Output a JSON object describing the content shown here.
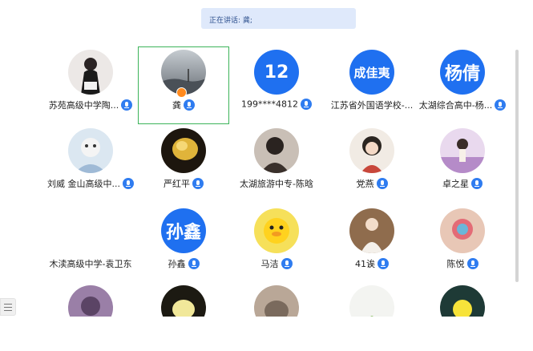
{
  "speaking_banner": "正在讲话: 龚;",
  "participants": [
    {
      "name": "苏苑高级中学陶...",
      "avatar": "photo",
      "mic": true
    },
    {
      "name": "龚",
      "avatar": "photo",
      "mic": true,
      "selected": true
    },
    {
      "name": "199****4812",
      "avatar": "letter",
      "avatar_text": "12",
      "mic": true
    },
    {
      "name": "江苏省外国语学校-...",
      "avatar": "letter",
      "avatar_text": "成佳夷",
      "mic": false
    },
    {
      "name": "太湖综合高中-杨...",
      "avatar": "letter",
      "avatar_text": "杨倩",
      "mic": true
    },
    {
      "name": "刘威 金山高级中...",
      "avatar": "photo",
      "mic": true
    },
    {
      "name": "严红平",
      "avatar": "photo",
      "mic": true
    },
    {
      "name": "太湖旅游中专-陈晗",
      "avatar": "photo",
      "mic": false
    },
    {
      "name": "党燕",
      "avatar": "photo",
      "mic": true
    },
    {
      "name": "卓之星",
      "avatar": "photo",
      "mic": true
    },
    {
      "name": "木渎高级中学-袁卫东",
      "avatar": "none",
      "mic": false
    },
    {
      "name": "孙鑫",
      "avatar": "letter",
      "avatar_text": "孙鑫",
      "mic": true
    },
    {
      "name": "马洁",
      "avatar": "photo",
      "mic": true
    },
    {
      "name": "41诶",
      "avatar": "photo",
      "mic": true
    },
    {
      "name": "陈悦",
      "avatar": "photo",
      "mic": true
    },
    {
      "name": "",
      "avatar": "photo",
      "mic": false
    },
    {
      "name": "",
      "avatar": "photo",
      "mic": false
    },
    {
      "name": "",
      "avatar": "photo",
      "mic": false
    },
    {
      "name": "",
      "avatar": "photo",
      "mic": false
    },
    {
      "name": "",
      "avatar": "photo",
      "mic": false
    }
  ],
  "colors": {
    "accent": "#1f70f0",
    "selected_border": "#3cb45a",
    "banner_bg": "#dfe9fb"
  },
  "icons": {
    "mic": "mic-icon",
    "host": "host-badge-icon",
    "participant_list": "list-icon"
  }
}
